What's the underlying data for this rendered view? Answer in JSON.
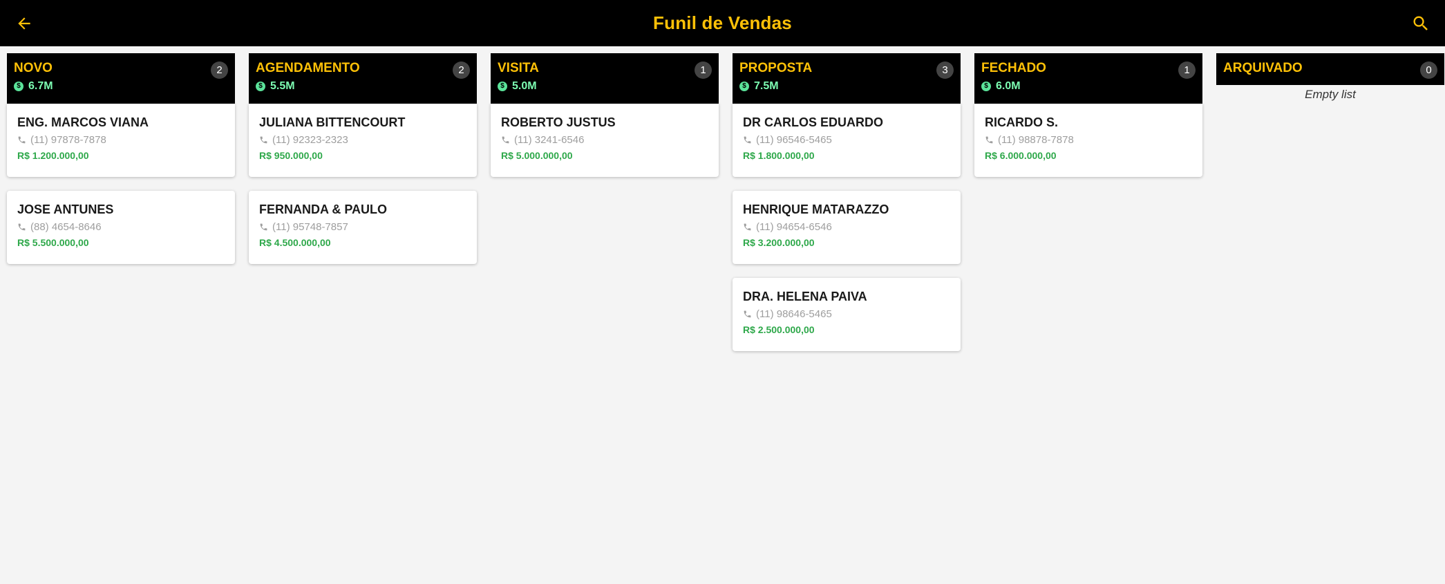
{
  "appbar": {
    "title": "Funil de Vendas",
    "back_icon": "arrow-left-icon",
    "search_icon": "search-icon"
  },
  "colors": {
    "header_bg": "#000000",
    "accent": "#ffc107",
    "total_green": "#7dffb3",
    "value_green": "#2ea84a",
    "background": "#f4f4f4"
  },
  "columns": [
    {
      "title": "NOVO",
      "count": "2",
      "total": "6.7M",
      "cards": [
        {
          "name": "ENG. MARCOS VIANA",
          "phone": "(11) 97878-7878",
          "value": "R$ 1.200.000,00"
        },
        {
          "name": "JOSE ANTUNES",
          "phone": "(88) 4654-8646",
          "value": "R$ 5.500.000,00"
        }
      ]
    },
    {
      "title": "AGENDAMENTO",
      "count": "2",
      "total": "5.5M",
      "cards": [
        {
          "name": "JULIANA BITTENCOURT",
          "phone": "(11) 92323-2323",
          "value": "R$ 950.000,00"
        },
        {
          "name": "FERNANDA & PAULO",
          "phone": "(11) 95748-7857",
          "value": "R$ 4.500.000,00"
        }
      ]
    },
    {
      "title": "VISITA",
      "count": "1",
      "total": "5.0M",
      "cards": [
        {
          "name": "ROBERTO JUSTUS",
          "phone": "(11) 3241-6546",
          "value": "R$ 5.000.000,00"
        }
      ]
    },
    {
      "title": "PROPOSTA",
      "count": "3",
      "total": "7.5M",
      "cards": [
        {
          "name": "DR CARLOS EDUARDO",
          "phone": "(11) 96546-5465",
          "value": "R$ 1.800.000,00"
        },
        {
          "name": "HENRIQUE MATARAZZO",
          "phone": "(11) 94654-6546",
          "value": "R$ 3.200.000,00"
        },
        {
          "name": "DRA. HELENA PAIVA",
          "phone": "(11) 98646-5465",
          "value": "R$ 2.500.000,00"
        }
      ]
    },
    {
      "title": "FECHADO",
      "count": "1",
      "total": "6.0M",
      "cards": [
        {
          "name": "RICARDO S.",
          "phone": "(11) 98878-7878",
          "value": "R$ 6.000.000,00"
        }
      ]
    },
    {
      "title": "ARQUIVADO",
      "count": "0",
      "empty_text": "Empty list",
      "cards": []
    }
  ]
}
